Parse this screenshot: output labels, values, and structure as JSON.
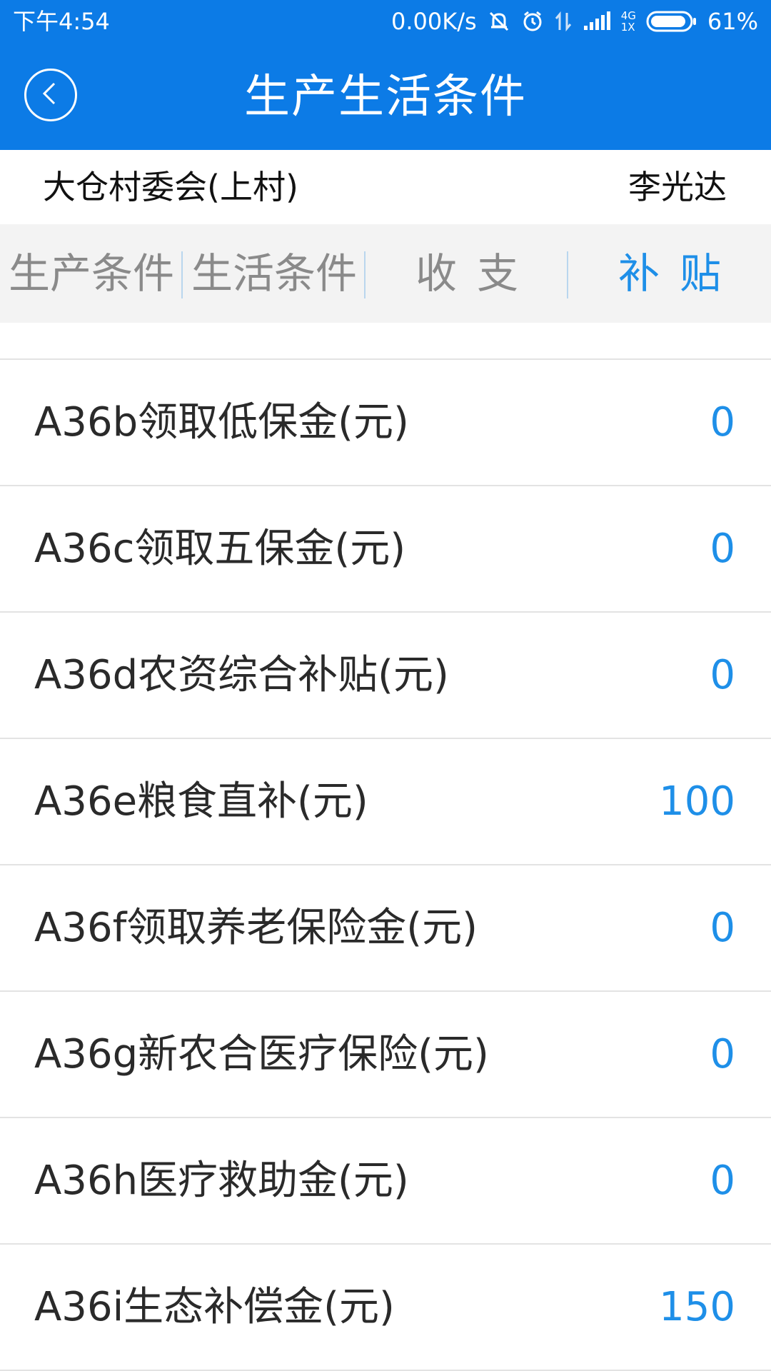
{
  "status_bar": {
    "time": "下午4:54",
    "net_speed": "0.00K/s",
    "network_label_top": "4G",
    "network_label_bottom": "1X",
    "battery_percent": "61%",
    "icons": [
      "vibrate-off-icon",
      "alarm-icon",
      "data-transfer-icon",
      "signal-icon",
      "battery-icon"
    ]
  },
  "header": {
    "title": "生产生活条件",
    "back_icon": "chevron-left-icon",
    "background_color": "#0c7be6"
  },
  "info": {
    "organization": "大仓村委会(上村)",
    "person": "李光达"
  },
  "tabs": [
    {
      "label": "生产条件",
      "active": false
    },
    {
      "label": "生活条件",
      "active": false
    },
    {
      "label": "收支",
      "active": false
    },
    {
      "label": "补贴",
      "active": true
    }
  ],
  "accent_color": "#1e8fe8",
  "items": [
    {
      "label": "A36b领取低保金(元)",
      "value": "0"
    },
    {
      "label": "A36c领取五保金(元)",
      "value": "0"
    },
    {
      "label": "A36d农资综合补贴(元)",
      "value": "0"
    },
    {
      "label": "A36e粮食直补(元)",
      "value": "100"
    },
    {
      "label": "A36f领取养老保险金(元)",
      "value": "0"
    },
    {
      "label": "A36g新农合医疗保险(元)",
      "value": "0"
    },
    {
      "label": "A36h医疗救助金(元)",
      "value": "0"
    },
    {
      "label": "A36i生态补偿金(元)",
      "value": "150"
    }
  ]
}
